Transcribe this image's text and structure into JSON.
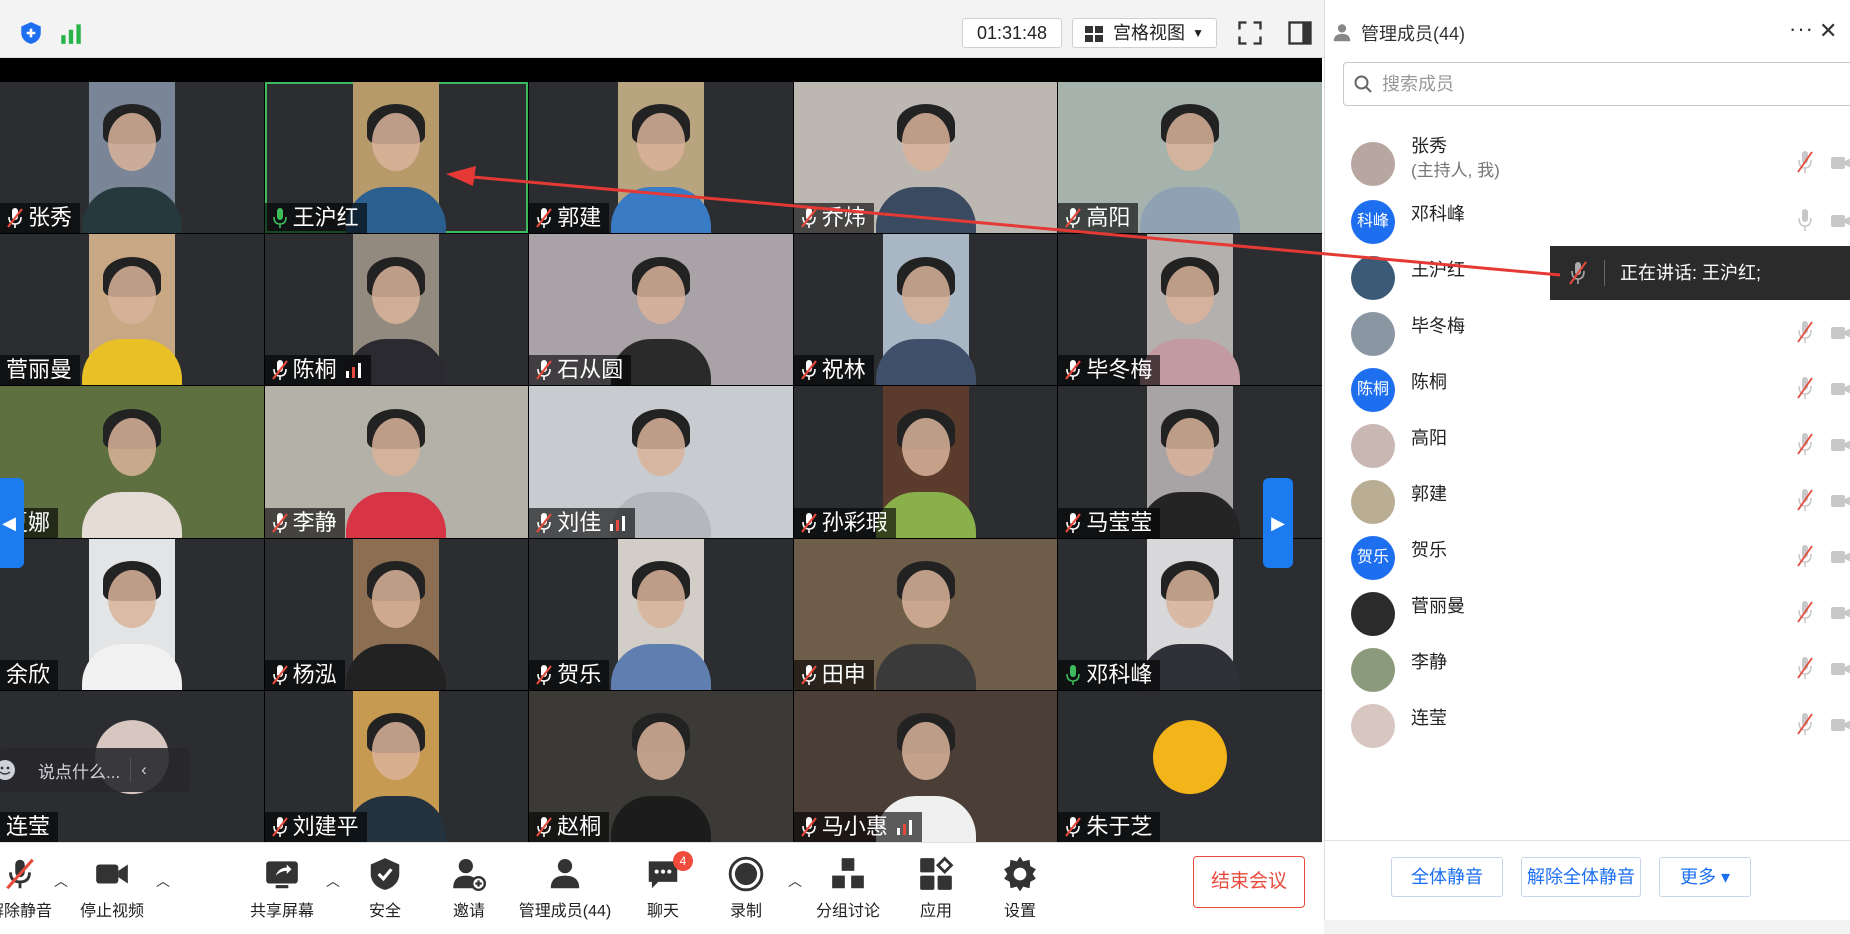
{
  "topbar": {
    "timer": "01:31:48",
    "view_mode": "宫格视图"
  },
  "tiles": [
    {
      "name": "张秀",
      "muted": true,
      "bg": "#7a8598",
      "shirt": "#263a3d"
    },
    {
      "name": "王沪红",
      "muted": false,
      "active": true,
      "bg": "#b69a6a",
      "shirt": "#2b5f8f"
    },
    {
      "name": "郭建",
      "muted": true,
      "bg": "#b8a47f",
      "shirt": "#3a7bc6"
    },
    {
      "name": "乔炜",
      "muted": true,
      "bg": "#bdb7b2",
      "shirt": "#3a4a60",
      "wide": true
    },
    {
      "name": "高阳",
      "muted": true,
      "bg": "#a6b3ad",
      "shirt": "#8fa2b4",
      "wide": true
    },
    {
      "name": "菅丽曼",
      "muted": false,
      "bg": "#c8a884",
      "shirt": "#e9c127"
    },
    {
      "name": "陈桐",
      "muted": true,
      "signal": true,
      "bg": "#928a7f",
      "shirt": "#2a2a30"
    },
    {
      "name": "石从圆",
      "muted": true,
      "bg": "#a9a3a8",
      "shirt": "#2a2a2a",
      "wide": true
    },
    {
      "name": "祝林",
      "muted": true,
      "bg": "#a9b7c4",
      "shirt": "#40506a"
    },
    {
      "name": "毕冬梅",
      "muted": true,
      "bg": "#b4b0ae",
      "shirt": "#c39aa0"
    },
    {
      "name": "夏娜",
      "muted": false,
      "bg": "#5f7040",
      "shirt": "#e6dcd6",
      "wide": true
    },
    {
      "name": "李静",
      "muted": true,
      "bg": "#b4b1a8",
      "shirt": "#d73445",
      "wide": true
    },
    {
      "name": "刘佳",
      "muted": true,
      "signal": true,
      "bg": "#c8cbcf",
      "shirt": "#b4b7bb",
      "wide": true
    },
    {
      "name": "孙彩瑕",
      "muted": true,
      "bg": "#5a3b2c",
      "shirt": "#8ab04c"
    },
    {
      "name": "马莹莹",
      "muted": true,
      "bg": "#a8a4a6",
      "shirt": "#242424"
    },
    {
      "name": "余欣",
      "muted": false,
      "bg": "#e3e4e6",
      "shirt": "#f1f1f1"
    },
    {
      "name": "杨泓",
      "muted": true,
      "bg": "#8c6e52",
      "shirt": "#222222"
    },
    {
      "name": "贺乐",
      "muted": true,
      "bg": "#d2cdc6",
      "shirt": "#5f7fb0"
    },
    {
      "name": "田申",
      "muted": true,
      "bg": "#6e5d48",
      "shirt": "#3a3a3a",
      "wide": true
    },
    {
      "name": "邓科峰",
      "muted": false,
      "micon": true,
      "bg": "#d8d7d9",
      "shirt": "#303038"
    },
    {
      "name": "连莹",
      "muted": false,
      "avatar": true,
      "avatar_color": "#d8c7c0"
    },
    {
      "name": "刘建平",
      "muted": true,
      "bg": "#c79a52",
      "shirt": "#24323e"
    },
    {
      "name": "赵桐",
      "muted": true,
      "bg": "#3b3a36",
      "shirt": "#1c1c1c",
      "wide": true
    },
    {
      "name": "马小惠",
      "muted": true,
      "signal": true,
      "bg": "#4a3e36",
      "shirt": "#f0f0f0",
      "wide": true
    },
    {
      "name": "朱于芝",
      "muted": true,
      "avatar": true,
      "avatar_color": "#f3b419"
    }
  ],
  "chat_placeholder": "说点什么...",
  "toolbar": {
    "unmute": "解除静音",
    "stop_video": "停止视频",
    "share_screen": "共享屏幕",
    "security": "安全",
    "invite": "邀请",
    "manage_members": "管理成员(44)",
    "chat": "聊天",
    "chat_badge": "4",
    "record": "录制",
    "breakout": "分组讨论",
    "apps": "应用",
    "settings": "设置",
    "end_meeting": "结束会议"
  },
  "panel": {
    "title": "管理成员(44)",
    "more": "···",
    "close": "✕",
    "search_placeholder": "搜索成员",
    "members": [
      {
        "name": "张秀",
        "sub": "(主持人, 我)",
        "avatar_color": "#b8a6a0",
        "muted": true
      },
      {
        "name": "邓科峰",
        "avatar_text": "科峰",
        "avatar_color": "#1e6ff0",
        "muted": false
      },
      {
        "name": "王沪红",
        "avatar_color": "#3b5a78",
        "muted": false
      },
      {
        "name": "毕冬梅",
        "avatar_color": "#8b96a3",
        "muted": true
      },
      {
        "name": "陈桐",
        "avatar_text": "陈桐",
        "avatar_color": "#1e6ff0",
        "muted": true
      },
      {
        "name": "高阳",
        "avatar_color": "#c8b7b3",
        "muted": true
      },
      {
        "name": "郭建",
        "avatar_color": "#b9ad93",
        "muted": true
      },
      {
        "name": "贺乐",
        "avatar_text": "贺乐",
        "avatar_color": "#1e6ff0",
        "muted": true
      },
      {
        "name": "菅丽曼",
        "avatar_color": "#2b2b2b",
        "muted": true
      },
      {
        "name": "李静",
        "avatar_color": "#8c9a7c",
        "muted": true
      },
      {
        "name": "连莹",
        "avatar_color": "#d8c7c0",
        "muted": true
      }
    ],
    "mute_all": "全体静音",
    "unmute_all": "解除全体静音",
    "more_btn": "更多 ▾"
  },
  "speaking": "正在讲话: 王沪红;",
  "colors": {
    "accent": "#1d6ff2",
    "danger": "#e84a3c",
    "active_green": "#3dbb5c",
    "mute_red": "#e64a3c"
  }
}
